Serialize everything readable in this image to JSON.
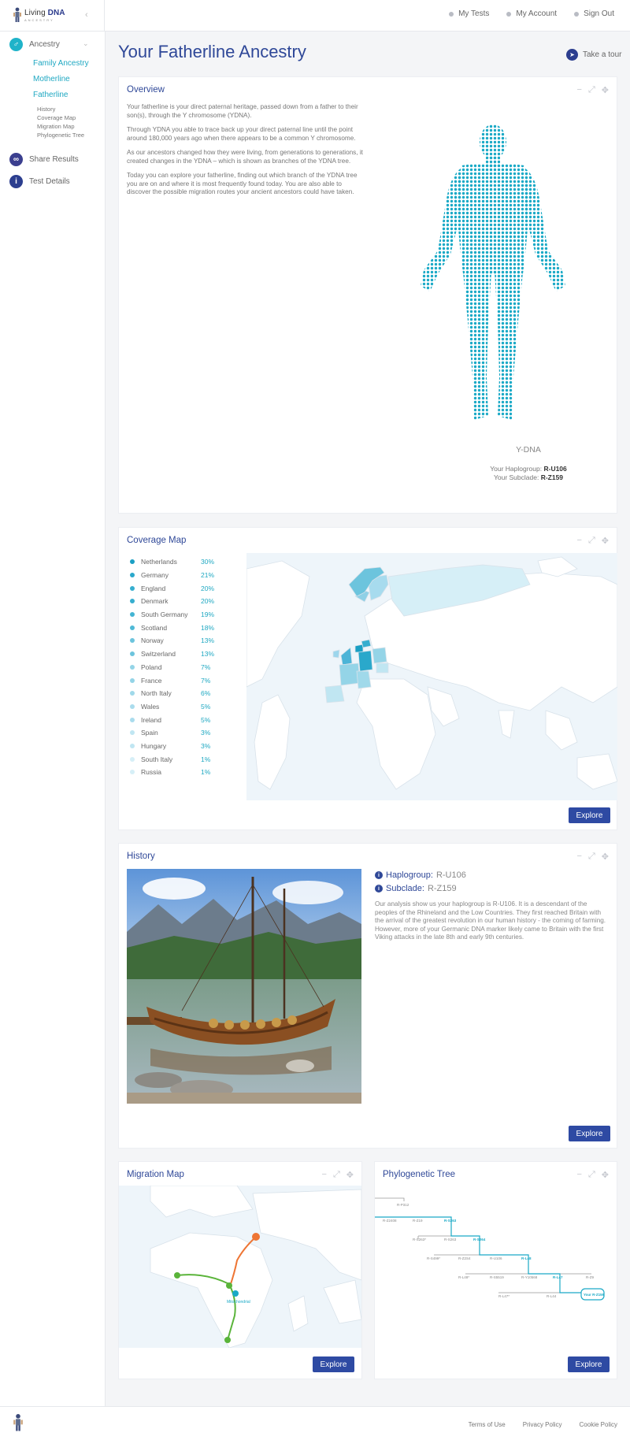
{
  "brand": {
    "name_light": "Living",
    "name_bold": "DNA",
    "tagline": "ANCESTRY"
  },
  "topnav": [
    "My Tests",
    "My Account",
    "Sign Out"
  ],
  "sidebar": {
    "ancestry": "Ancestry",
    "sub": [
      "Family Ancestry",
      "Motherline",
      "Fatherline"
    ],
    "subsub": [
      "History",
      "Coverage Map",
      "Migration Map",
      "Phylogenetic Tree"
    ],
    "share": "Share Results",
    "details": "Test Details"
  },
  "page_title": "Your Fatherline Ancestry",
  "tour": "Take a tour",
  "overview": {
    "title": "Overview",
    "paragraphs": [
      "Your fatherline is your direct paternal heritage, passed down from a father to their son(s), through the Y chromosome (YDNA).",
      "Through YDNA you able to trace back up your direct paternal line until the point around 180,000 years ago when there appears to be a common Y chromosome.",
      "As our ancestors changed how they were living, from generations to generations, it created changes in the YDNA – which is shown as branches of the YDNA tree.",
      "Today you can explore your fatherline, finding out which branch of the YDNA tree you are on and where it is most frequently found today. You are also able to discover the possible migration routes your ancient ancestors could have taken."
    ],
    "figure_label": "Y-DNA",
    "haplogroup_label": "Your Haplogroup:",
    "haplogroup": "R-U106",
    "subclade_label": "Your Subclade:",
    "subclade": "R-Z159"
  },
  "coverage": {
    "title": "Coverage Map",
    "explore": "Explore",
    "regions": [
      {
        "name": "Netherlands",
        "pct": "30%",
        "color": "#1a9fc4"
      },
      {
        "name": "Germany",
        "pct": "21%",
        "color": "#2aa8cb"
      },
      {
        "name": "England",
        "pct": "20%",
        "color": "#36aecf"
      },
      {
        "name": "Denmark",
        "pct": "20%",
        "color": "#36aecf"
      },
      {
        "name": "South Germany",
        "pct": "19%",
        "color": "#43b4d3"
      },
      {
        "name": "Scotland",
        "pct": "18%",
        "color": "#4fb9d6"
      },
      {
        "name": "Norway",
        "pct": "13%",
        "color": "#6cc4dd"
      },
      {
        "name": "Switzerland",
        "pct": "13%",
        "color": "#6cc4dd"
      },
      {
        "name": "Poland",
        "pct": "7%",
        "color": "#94d4e7"
      },
      {
        "name": "France",
        "pct": "7%",
        "color": "#94d4e7"
      },
      {
        "name": "North Italy",
        "pct": "6%",
        "color": "#a0d9ea"
      },
      {
        "name": "Wales",
        "pct": "5%",
        "color": "#aadced"
      },
      {
        "name": "Ireland",
        "pct": "5%",
        "color": "#aadced"
      },
      {
        "name": "Spain",
        "pct": "3%",
        "color": "#c0e6f2"
      },
      {
        "name": "Hungary",
        "pct": "3%",
        "color": "#c0e6f2"
      },
      {
        "name": "South Italy",
        "pct": "1%",
        "color": "#d6eff7"
      },
      {
        "name": "Russia",
        "pct": "1%",
        "color": "#d6eff7"
      }
    ]
  },
  "history": {
    "title": "History",
    "haplogroup_label": "Haplogroup:",
    "haplogroup": "R-U106",
    "subclade_label": "Subclade:",
    "subclade": "R-Z159",
    "body": "Our analysis show us your haplogroup is R-U106. It is a descendant of the peoples of the Rhineland and the Low Countries. They first reached Britain with the arrival of the greatest revolution in our human history - the coming of farming. However, more of your Germanic DNA marker likely came to Britain with the first Viking attacks in the late 8th and early 9th centuries.",
    "explore": "Explore"
  },
  "migration": {
    "title": "Migration Map",
    "explore": "Explore",
    "start_label": "Mitochondrial"
  },
  "tree": {
    "title": "Phylogenetic Tree",
    "explore": "Explore",
    "nodes": [
      "R-P312",
      "R-Z2408",
      "R-Z19",
      "R-S263",
      "R-S263*",
      "R-S263",
      "R-S264",
      "R-S499*",
      "R-Z2S4",
      "R-U106",
      "R-L48",
      "R-L48*",
      "R-S5519",
      "R-Y10568",
      "R-L47",
      "R-Z9",
      "R-L47*",
      "R-L44",
      "Your R-Z159"
    ]
  },
  "footer": {
    "links": [
      "Terms of Use",
      "Privacy Policy",
      "Cookie Policy"
    ]
  }
}
